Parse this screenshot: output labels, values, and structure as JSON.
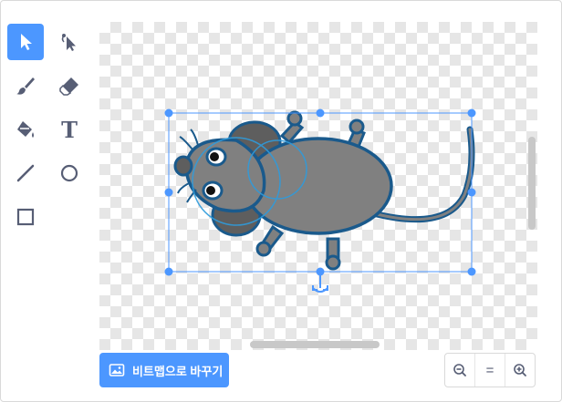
{
  "tools": [
    {
      "name": "select-tool",
      "icon": "arrow-cursor-icon",
      "selected": true
    },
    {
      "name": "reshape-tool",
      "icon": "reshape-cursor-icon",
      "selected": false
    },
    {
      "name": "brush-tool",
      "icon": "brush-icon",
      "selected": false
    },
    {
      "name": "eraser-tool",
      "icon": "eraser-icon",
      "selected": false
    },
    {
      "name": "fill-tool",
      "icon": "paint-bucket-icon",
      "selected": false
    },
    {
      "name": "text-tool",
      "icon": "text-T-icon",
      "text": "T",
      "selected": false
    },
    {
      "name": "line-tool",
      "icon": "line-icon",
      "selected": false
    },
    {
      "name": "circle-tool",
      "icon": "circle-icon",
      "selected": false
    },
    {
      "name": "rectangle-tool",
      "icon": "square-icon",
      "selected": false
    }
  ],
  "canvas": {
    "subject": "mouse-sprite",
    "colors": {
      "body": "#808080",
      "outline": "#1a5a8c",
      "selection": "#4c97ff",
      "ear_fill": "#5e5e5e"
    }
  },
  "convert_button": {
    "label": "비트맵으로 바꾸기",
    "icon": "image-icon"
  },
  "zoom": {
    "zoom_out_icon": "zoom-out-icon",
    "reset_label": "=",
    "zoom_in_icon": "zoom-in-icon"
  },
  "accent_color": "#4c97ff"
}
